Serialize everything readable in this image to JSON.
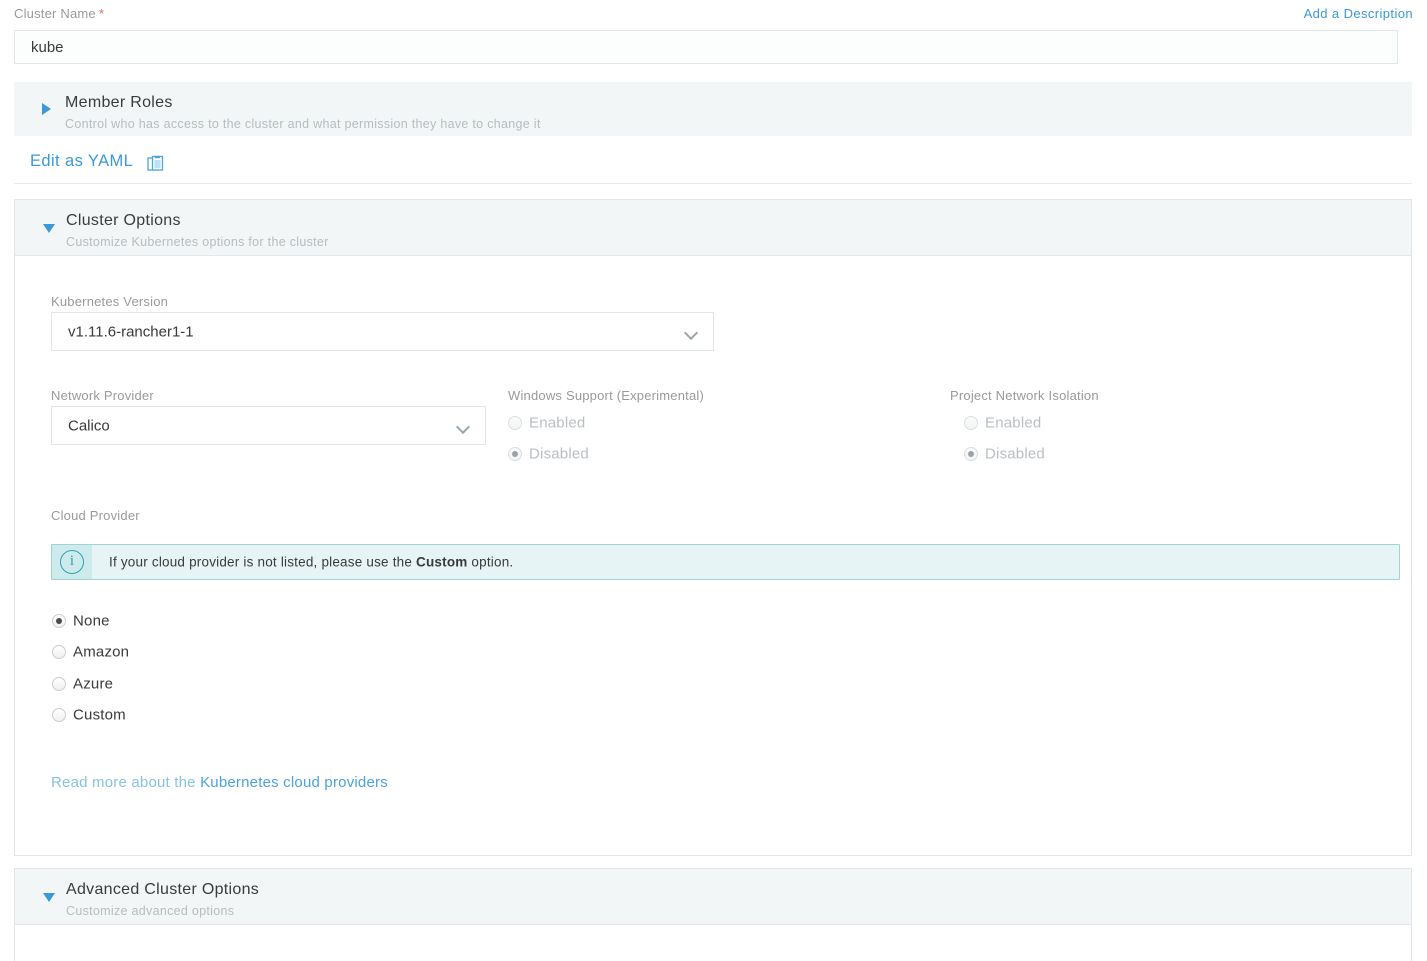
{
  "cluster_name_field": {
    "label": "Cluster Name",
    "required_marker": "*",
    "value": "kube",
    "add_description_link": "Add a Description"
  },
  "member_roles": {
    "title": "Member Roles",
    "subtitle": "Control who has access to the cluster and what permission they have to change it",
    "expanded": false,
    "toggle_icon": "triangle-right-icon"
  },
  "yaml": {
    "link_label": "Edit as YAML",
    "icon": "clipboard-copy-icon"
  },
  "cluster_options": {
    "title": "Cluster Options",
    "subtitle": "Customize Kubernetes options for the cluster",
    "expanded": true,
    "toggle_icon": "triangle-down-icon",
    "kubernetes_version": {
      "label": "Kubernetes Version",
      "value": "v1.11.6-rancher1-1",
      "chevron_icon": "chevron-down-icon"
    },
    "network_provider": {
      "label": "Network Provider",
      "value": "Calico",
      "chevron_icon": "chevron-down-icon"
    },
    "windows_support": {
      "label": "Windows Support (Experimental)",
      "options": [
        {
          "label": "Enabled",
          "checked": false,
          "disabled": true
        },
        {
          "label": "Disabled",
          "checked": true,
          "disabled": true
        }
      ]
    },
    "project_network_isolation": {
      "label": "Project Network Isolation",
      "options": [
        {
          "label": "Enabled",
          "checked": false,
          "disabled": true
        },
        {
          "label": "Disabled",
          "checked": true,
          "disabled": true
        }
      ]
    },
    "cloud_provider": {
      "label": "Cloud Provider",
      "banner": {
        "icon": "info-circle-icon",
        "text_before": "If your cloud provider is not listed, please use the ",
        "text_bold": "Custom",
        "text_after": " option."
      },
      "options": [
        {
          "label": "None",
          "checked": true
        },
        {
          "label": "Amazon",
          "checked": false
        },
        {
          "label": "Azure",
          "checked": false
        },
        {
          "label": "Custom",
          "checked": false
        }
      ],
      "read_more_prefix": "Read more about the ",
      "read_more_link": "Kubernetes cloud providers"
    }
  },
  "advanced_cluster_options": {
    "title": "Advanced Cluster Options",
    "subtitle": "Customize advanced options",
    "expanded": true,
    "toggle_icon": "triangle-down-icon"
  },
  "colors": {
    "link": "#3d98d3",
    "required": "#e8636f",
    "panel_header_bg": "#f2f6f7",
    "banner_bg": "#e6f4f5",
    "banner_border": "#9fd4d7",
    "banner_icon": "#2fa3ad"
  }
}
